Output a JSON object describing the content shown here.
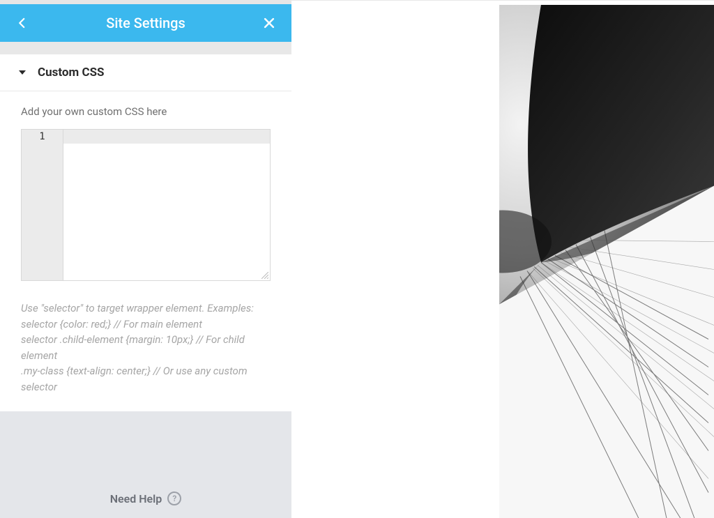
{
  "header": {
    "title": "Site Settings"
  },
  "section": {
    "title": "Custom CSS",
    "intro": "Add your own custom CSS here",
    "editor": {
      "line_number": "1",
      "value": ""
    },
    "hint": "Use \"selector\" to target wrapper element. Examples:\nselector {color: red;} // For main element\nselector .child-element {margin: 10px;} // For child element\n.my-class {text-align: center;} // Or use any custom selector"
  },
  "footer": {
    "need_help": "Need Help"
  },
  "colors": {
    "accent": "#3bb8ee"
  }
}
